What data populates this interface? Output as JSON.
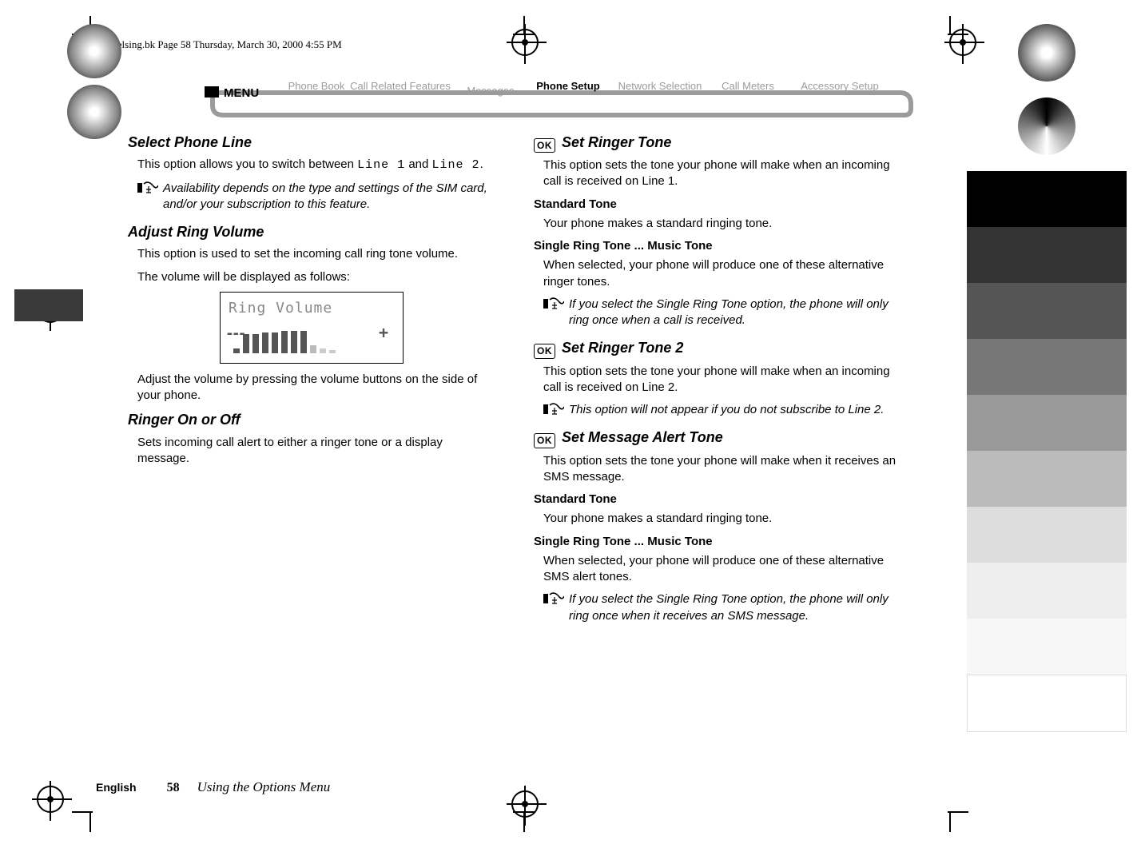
{
  "header_line": "angelsing.bk  Page 58  Thursday, March 30, 2000  4:55 PM",
  "menubar": {
    "menu": "MENU",
    "items": [
      "Phone Book",
      "Call Related Features",
      "Messages",
      "Phone Setup",
      "Network Selection",
      "Call Meters",
      "Accessory Setup"
    ]
  },
  "left": {
    "h_select": "Select Phone Line",
    "select_body_a": "This option allows you to switch between ",
    "select_code1": "Line 1",
    "select_mid": " and ",
    "select_code2": "Line 2",
    "select_tail": ".",
    "select_note": "Availability depends on the type and settings of the SIM card, and/or your subscription to this feature.",
    "h_adjust": "Adjust Ring Volume",
    "adjust_body1": "This option is used to set the incoming call ring tone volume.",
    "adjust_body2": "The volume will be displayed as follows:",
    "lcd_title": "Ring Volume",
    "adjust_body3": "Adjust the volume by pressing the volume buttons on the side of your phone.",
    "h_ringer": "Ringer On or Off",
    "ringer_body": "Sets incoming call alert to either a ringer tone or a display message."
  },
  "right": {
    "ok": "OK",
    "h_tone1": "Set Ringer Tone",
    "tone1_body": "This option sets the tone your phone will make when an incoming call is received on Line 1.",
    "std_label": "Standard Tone",
    "std_body": "Your phone makes a standard ringing tone.",
    "single_label": "Single Ring Tone ... Music Tone",
    "single_body": "When selected, your phone will produce one of these alternative ringer tones.",
    "single_note": "If you select the Single Ring Tone option, the phone will only ring once when a call is received.",
    "h_tone2": "Set Ringer Tone 2",
    "tone2_body": "This option sets the tone your phone will make when an incoming call is received on Line 2.",
    "tone2_note": "This option will not appear if you do not subscribe to Line 2.",
    "h_msg": "Set Message Alert Tone",
    "msg_body": "This option sets the tone your phone will make when it receives an SMS message.",
    "std2_label": "Standard Tone",
    "std2_body": "Your phone makes a standard ringing tone.",
    "single2_label": "Single Ring Tone ... Music Tone",
    "single2_body": "When selected, your phone will produce one of these alternative SMS alert tones.",
    "single2_note": "If you select the Single Ring Tone option, the phone will only ring once when it receives an SMS message."
  },
  "footer": {
    "lang": "English",
    "page": "58",
    "chapter": "Using the Options Menu"
  },
  "colors": {
    "active": "#000",
    "inactive": "#9b9b9b",
    "darktab": "#404040"
  }
}
